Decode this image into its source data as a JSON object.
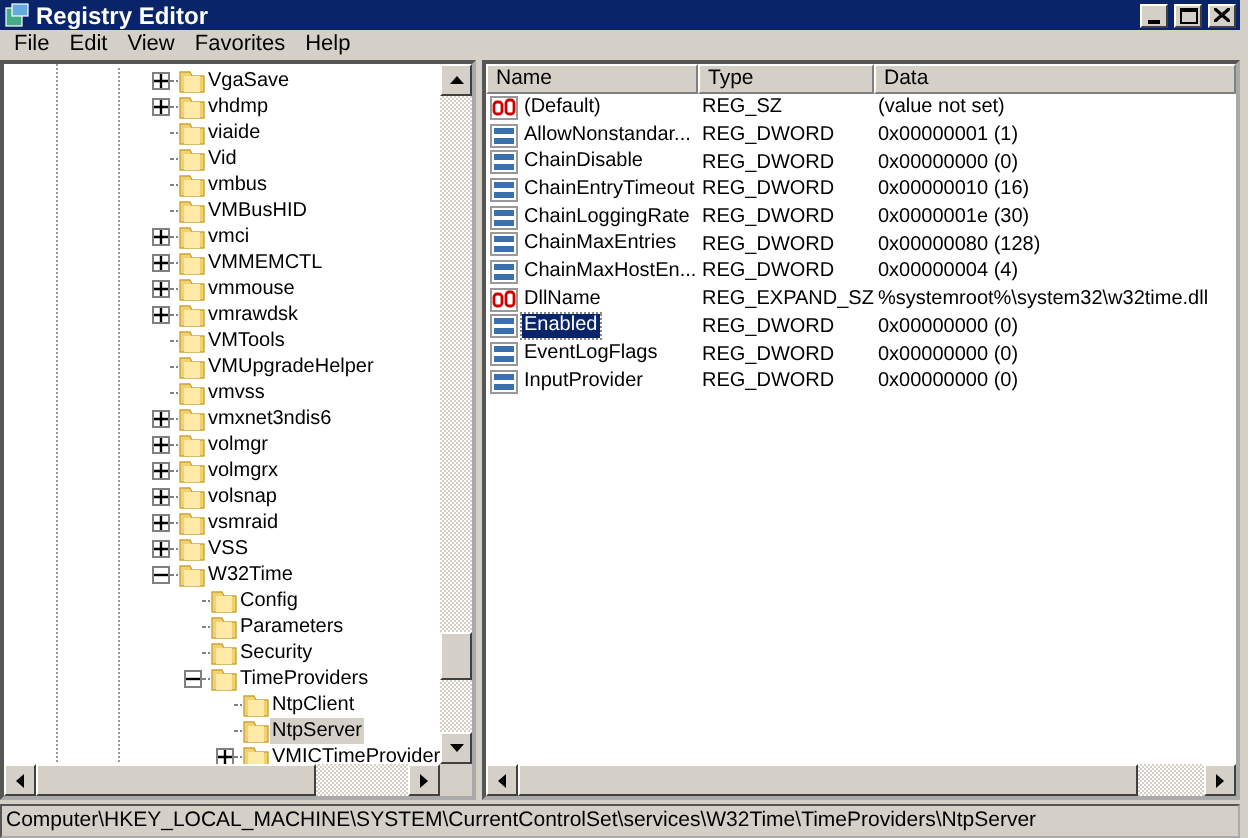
{
  "window": {
    "title": "Registry Editor"
  },
  "menu": [
    "File",
    "Edit",
    "View",
    "Favorites",
    "Help"
  ],
  "tree": {
    "items": [
      {
        "label": "VgaSave",
        "expandable": true,
        "expanded": false,
        "selected": false
      },
      {
        "label": "vhdmp",
        "expandable": true,
        "expanded": false,
        "selected": false
      },
      {
        "label": "viaide",
        "expandable": false,
        "expanded": false,
        "selected": false
      },
      {
        "label": "Vid",
        "expandable": false,
        "expanded": false,
        "selected": false
      },
      {
        "label": "vmbus",
        "expandable": false,
        "expanded": false,
        "selected": false
      },
      {
        "label": "VMBusHID",
        "expandable": false,
        "expanded": false,
        "selected": false
      },
      {
        "label": "vmci",
        "expandable": true,
        "expanded": false,
        "selected": false
      },
      {
        "label": "VMMEMCTL",
        "expandable": true,
        "expanded": false,
        "selected": false
      },
      {
        "label": "vmmouse",
        "expandable": true,
        "expanded": false,
        "selected": false
      },
      {
        "label": "vmrawdsk",
        "expandable": true,
        "expanded": false,
        "selected": false
      },
      {
        "label": "VMTools",
        "expandable": false,
        "expanded": false,
        "selected": false
      },
      {
        "label": "VMUpgradeHelper",
        "expandable": false,
        "expanded": false,
        "selected": false
      },
      {
        "label": "vmvss",
        "expandable": false,
        "expanded": false,
        "selected": false
      },
      {
        "label": "vmxnet3ndis6",
        "expandable": true,
        "expanded": false,
        "selected": false
      },
      {
        "label": "volmgr",
        "expandable": true,
        "expanded": false,
        "selected": false
      },
      {
        "label": "volmgrx",
        "expandable": true,
        "expanded": false,
        "selected": false
      },
      {
        "label": "volsnap",
        "expandable": true,
        "expanded": false,
        "selected": false
      },
      {
        "label": "vsmraid",
        "expandable": true,
        "expanded": false,
        "selected": false
      },
      {
        "label": "VSS",
        "expandable": true,
        "expanded": false,
        "selected": false
      },
      {
        "label": "W32Time",
        "expandable": true,
        "expanded": true,
        "selected": false,
        "children": [
          {
            "label": "Config",
            "expandable": false,
            "expanded": false,
            "selected": false
          },
          {
            "label": "Parameters",
            "expandable": false,
            "expanded": false,
            "selected": false
          },
          {
            "label": "Security",
            "expandable": false,
            "expanded": false,
            "selected": false
          },
          {
            "label": "TimeProviders",
            "expandable": true,
            "expanded": true,
            "selected": false,
            "children": [
              {
                "label": "NtpClient",
                "expandable": false,
                "expanded": false,
                "selected": false
              },
              {
                "label": "NtpServer",
                "expandable": false,
                "expanded": false,
                "selected": true
              },
              {
                "label": "VMICTimeProvider",
                "expandable": true,
                "expanded": false,
                "selected": false
              }
            ]
          }
        ]
      }
    ]
  },
  "values": {
    "columns": [
      "Name",
      "Type",
      "Data"
    ],
    "rows": [
      {
        "kind": "string",
        "name": "(Default)",
        "type": "REG_SZ",
        "data": "(value not set)",
        "selected": false
      },
      {
        "kind": "number",
        "name": "AllowNonstandar...",
        "type": "REG_DWORD",
        "data": "0x00000001 (1)",
        "selected": false
      },
      {
        "kind": "number",
        "name": "ChainDisable",
        "type": "REG_DWORD",
        "data": "0x00000000 (0)",
        "selected": false
      },
      {
        "kind": "number",
        "name": "ChainEntryTimeout",
        "type": "REG_DWORD",
        "data": "0x00000010 (16)",
        "selected": false
      },
      {
        "kind": "number",
        "name": "ChainLoggingRate",
        "type": "REG_DWORD",
        "data": "0x0000001e (30)",
        "selected": false
      },
      {
        "kind": "number",
        "name": "ChainMaxEntries",
        "type": "REG_DWORD",
        "data": "0x00000080 (128)",
        "selected": false
      },
      {
        "kind": "number",
        "name": "ChainMaxHostEn...",
        "type": "REG_DWORD",
        "data": "0x00000004 (4)",
        "selected": false
      },
      {
        "kind": "string",
        "name": "DllName",
        "type": "REG_EXPAND_SZ",
        "data": "%systemroot%\\system32\\w32time.dll",
        "selected": false
      },
      {
        "kind": "number",
        "name": "Enabled",
        "type": "REG_DWORD",
        "data": "0x00000000 (0)",
        "selected": true
      },
      {
        "kind": "number",
        "name": "EventLogFlags",
        "type": "REG_DWORD",
        "data": "0x00000000 (0)",
        "selected": false
      },
      {
        "kind": "number",
        "name": "InputProvider",
        "type": "REG_DWORD",
        "data": "0x00000000 (0)",
        "selected": false
      }
    ]
  },
  "status_bar": "Computer\\HKEY_LOCAL_MACHINE\\SYSTEM\\CurrentControlSet\\services\\W32Time\\TimeProviders\\NtpServer"
}
